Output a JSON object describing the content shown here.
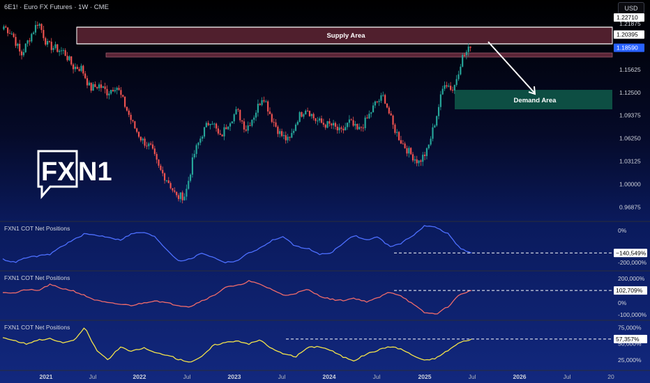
{
  "header": {
    "symbol_title": "6E1! · Euro FX Futures · 1W · CME",
    "currency": "USD"
  },
  "logo": {
    "text_left": "FX",
    "text_right": "N1"
  },
  "annotations": {
    "supply": "Supply Area",
    "demand": "Demand Area"
  },
  "colors": {
    "up": "#26a69a",
    "down": "#ef5350",
    "blue": "#4d6fff",
    "red": "#f06b6b",
    "yellow": "#f3e34a"
  },
  "chart_data": [
    {
      "type": "candlestick",
      "title": "6E1! · Euro FX Futures · 1W · CME",
      "y_ticks": [
        "1.21875",
        "1.18750",
        "1.15625",
        "1.12500",
        "1.09375",
        "1.06250",
        "1.03125",
        "1.00000",
        "0.96875"
      ],
      "ylim": [
        0.955,
        1.232
      ],
      "price_markers": [
        {
          "label": "1.22710",
          "value": 1.2271,
          "style": "white"
        },
        {
          "label": "1.20395",
          "value": 1.20395,
          "style": "white"
        },
        {
          "label": "1.18590",
          "value": 1.1859,
          "style": "blue"
        }
      ],
      "x_ticks": [
        "2021",
        "Jul",
        "2022",
        "Jul",
        "2023",
        "Jul",
        "2024",
        "Jul",
        "2025",
        "Jul",
        "2026",
        "Jul",
        "20"
      ],
      "close_path": [
        [
          "2021-01",
          1.215
        ],
        [
          "2021-02",
          1.205
        ],
        [
          "2021-03",
          1.175
        ],
        [
          "2021-04",
          1.2
        ],
        [
          "2021-05",
          1.222
        ],
        [
          "2021-06",
          1.19
        ],
        [
          "2021-07",
          1.185
        ],
        [
          "2021-08",
          1.18
        ],
        [
          "2021-09",
          1.16
        ],
        [
          "2021-10",
          1.158
        ],
        [
          "2021-11",
          1.13
        ],
        [
          "2021-12",
          1.135
        ],
        [
          "2022-01",
          1.125
        ],
        [
          "2022-02",
          1.135
        ],
        [
          "2022-03",
          1.108
        ],
        [
          "2022-04",
          1.08
        ],
        [
          "2022-05",
          1.06
        ],
        [
          "2022-06",
          1.05
        ],
        [
          "2022-07",
          1.02
        ],
        [
          "2022-08",
          1.005
        ],
        [
          "2022-09",
          0.982
        ],
        [
          "2022-10",
          0.985
        ],
        [
          "2022-11",
          1.04
        ],
        [
          "2022-12",
          1.07
        ],
        [
          "2023-01",
          1.09
        ],
        [
          "2023-02",
          1.062
        ],
        [
          "2023-03",
          1.085
        ],
        [
          "2023-04",
          1.1
        ],
        [
          "2023-05",
          1.075
        ],
        [
          "2023-06",
          1.095
        ],
        [
          "2023-07",
          1.122
        ],
        [
          "2023-08",
          1.09
        ],
        [
          "2023-09",
          1.068
        ],
        [
          "2023-10",
          1.058
        ],
        [
          "2023-11",
          1.09
        ],
        [
          "2023-12",
          1.105
        ],
        [
          "2024-01",
          1.088
        ],
        [
          "2024-02",
          1.082
        ],
        [
          "2024-03",
          1.08
        ],
        [
          "2024-04",
          1.07
        ],
        [
          "2024-05",
          1.085
        ],
        [
          "2024-06",
          1.072
        ],
        [
          "2024-07",
          1.088
        ],
        [
          "2024-08",
          1.11
        ],
        [
          "2024-09",
          1.12
        ],
        [
          "2024-10",
          1.08
        ],
        [
          "2024-11",
          1.058
        ],
        [
          "2024-12",
          1.042
        ],
        [
          "2025-01",
          1.03
        ],
        [
          "2025-02",
          1.045
        ],
        [
          "2025-03",
          1.09
        ],
        [
          "2025-04",
          1.14
        ],
        [
          "2025-05",
          1.128
        ],
        [
          "2025-06",
          1.172
        ],
        [
          "2025-06b",
          1.1859
        ]
      ]
    },
    {
      "type": "line",
      "title": "FXN1 COT Net Positions",
      "series": [
        {
          "name": "FXN1 COT Net Positions",
          "color": "#4d6fff"
        }
      ],
      "y_ticks": [
        "0%",
        "-200,000%"
      ],
      "ylim": [
        -240000,
        40000
      ],
      "last_value_label": "−140,549%",
      "last_value": -140549,
      "values": [
        -180000,
        -200000,
        -170000,
        -160000,
        -150000,
        -100000,
        -60000,
        -20000,
        -30000,
        -40000,
        -60000,
        -20000,
        -10000,
        -40000,
        -120000,
        -190000,
        -180000,
        -140000,
        -170000,
        -200000,
        -190000,
        -140000,
        -110000,
        -60000,
        -40000,
        -100000,
        -110000,
        -150000,
        -140000,
        -80000,
        -30000,
        -60000,
        -40000,
        -100000,
        -80000,
        -30000,
        30000,
        20000,
        -20000,
        -110000,
        -140549
      ]
    },
    {
      "type": "line",
      "title": "FXN1 COT Net Positions",
      "series": [
        {
          "name": "FXN1 COT Net Positions",
          "color": "#f06b6b"
        }
      ],
      "y_ticks": [
        "200,000%",
        "0%",
        "-100,000%"
      ],
      "ylim": [
        -125000,
        240000
      ],
      "last_value_label": "102,709%",
      "last_value": 102709,
      "values": [
        90000,
        80000,
        110000,
        100000,
        150000,
        120000,
        100000,
        60000,
        20000,
        0,
        -10000,
        -20000,
        0,
        20000,
        0,
        -20000,
        -30000,
        20000,
        60000,
        130000,
        140000,
        180000,
        150000,
        110000,
        60000,
        80000,
        110000,
        60000,
        30000,
        20000,
        40000,
        10000,
        40000,
        90000,
        60000,
        -10000,
        -80000,
        -90000,
        -30000,
        70000,
        102709
      ]
    },
    {
      "type": "line",
      "title": "FXN1 COT Net Positions",
      "series": [
        {
          "name": "FXN1 COT Net Positions",
          "color": "#f3e34a"
        }
      ],
      "y_ticks": [
        "75,000%",
        "50,000%",
        "25,000%"
      ],
      "ylim": [
        12000,
        82000
      ],
      "last_value_label": "57,357%",
      "last_value": 57357,
      "values": [
        60000,
        55000,
        50000,
        56000,
        58000,
        52000,
        54000,
        75000,
        40000,
        25000,
        45000,
        38000,
        44000,
        36000,
        33000,
        26000,
        22000,
        30000,
        48000,
        52000,
        55000,
        50000,
        56000,
        42000,
        34000,
        30000,
        44000,
        46000,
        40000,
        30000,
        24000,
        34000,
        40000,
        46000,
        42000,
        32000,
        24000,
        28000,
        40000,
        52000,
        57357
      ]
    }
  ]
}
